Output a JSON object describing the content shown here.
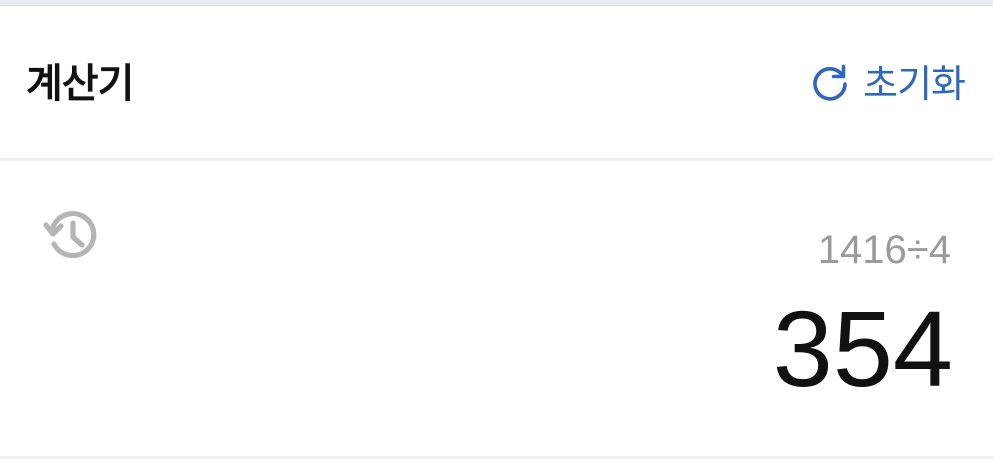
{
  "header": {
    "title": "계산기",
    "reset": {
      "label": "초기화",
      "icon": "refresh-icon",
      "color": "#2f67bf"
    }
  },
  "display": {
    "history_icon": "history-icon",
    "expression": "1416÷4",
    "result": "354"
  },
  "colors": {
    "accent": "#2f67bf",
    "text_primary": "#111111",
    "text_secondary": "#9a9a9a",
    "divider": "#eceef1"
  }
}
